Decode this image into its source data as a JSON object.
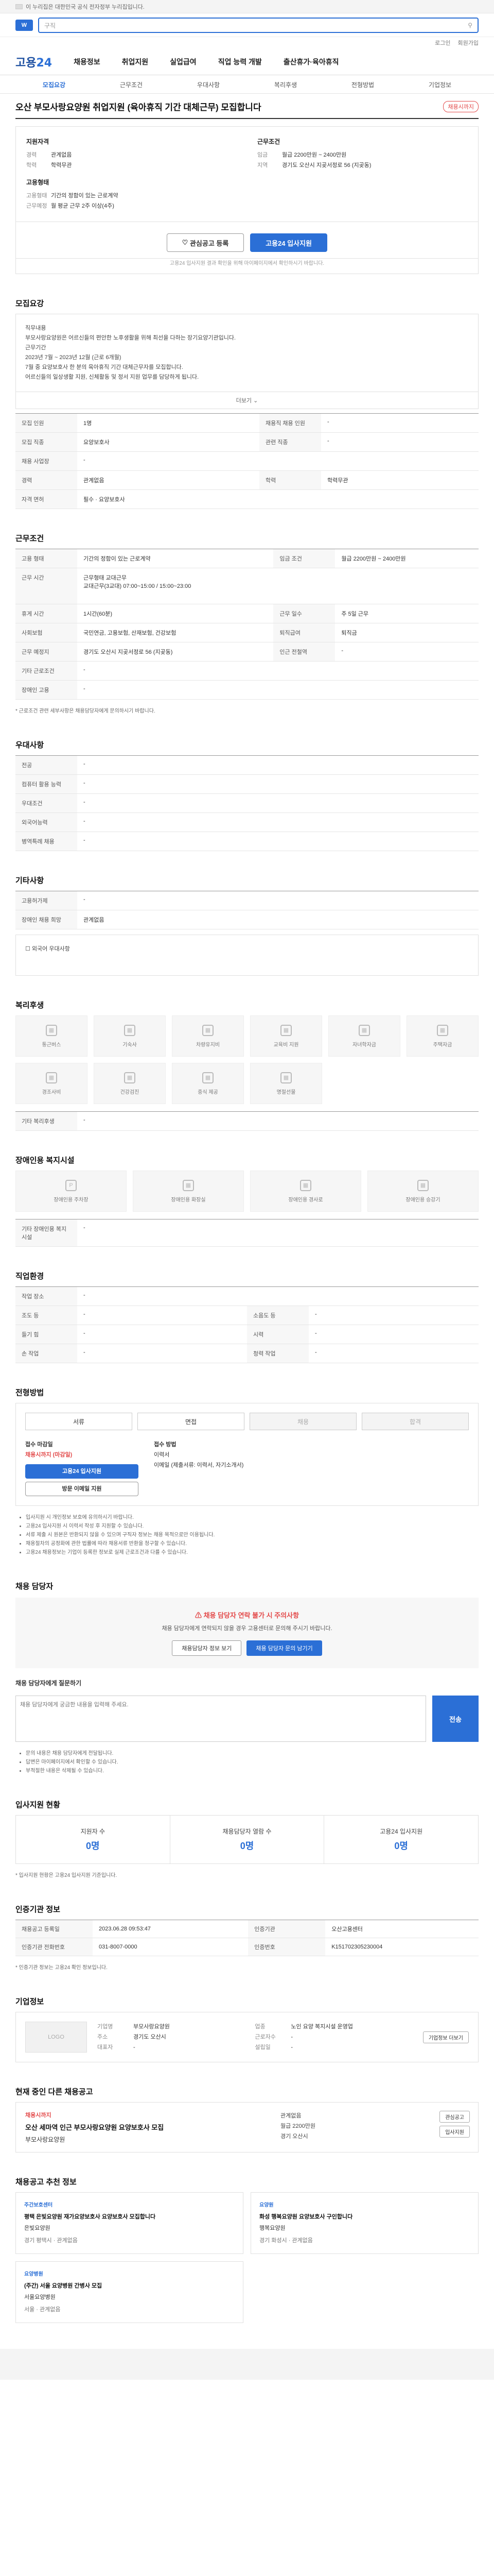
{
  "topbar": {
    "notice": "이 누리집은 대한민국 공식 전자정부 누리집입니다."
  },
  "search": {
    "placeholder": "구직"
  },
  "util": [
    "로그인",
    "회원가입"
  ],
  "gnb": {
    "brand_a": "고용",
    "brand_b": "24",
    "menu": [
      "채용정보",
      "취업지원",
      "실업급여",
      "직업 능력 개발",
      "출산휴가·육아휴직"
    ]
  },
  "lnb": [
    "모집요강",
    "근무조건",
    "우대사항",
    "복리후생",
    "전형방법",
    "기업정보"
  ],
  "title": {
    "text": "오산 부모사랑요양원 취업지원 (육아휴직 기간 대체근무) 모집합니다",
    "badge": "채용시까지"
  },
  "summary": {
    "left_h": "지원자격",
    "left": [
      [
        "경력",
        "관계없음"
      ],
      [
        "학력",
        "학력무관"
      ]
    ],
    "left2_h": "고용형태",
    "left2": [
      [
        "고용형태",
        "기간의 정함이 있는 근로계약"
      ],
      [
        "근무예정",
        "월 평균 근무 2주 이상(4주)"
      ]
    ],
    "right_h": "근무조건",
    "right": [
      [
        "임금",
        "월급 2200만원 ~ 2400만원"
      ],
      [
        "지역",
        "경기도 오산시 지곶서정로 56 (지곶동)"
      ]
    ]
  },
  "actions": {
    "save": "관심공고 등록",
    "apply": "고용24 입사지원"
  },
  "actions_note": "고용24 입사지원 결과 확인을 위해 마이페이지에서 확인하시기 바랍니다.",
  "s1": {
    "h": "모집요강",
    "text": [
      "직무내용",
      "부모사랑요양원은 어르신들의 편안한 노후생활을 위해 최선을 다하는 장기요양기관입니다.",
      "근무기간",
      "2023년 7월 ~ 2023년 12월 (근로 6개월)",
      "7월 중 요양보호사 한 분의 육아휴직 기간 대체근무자를 모집합니다.",
      "어르신들의 일상생활 지원, 신체활동 및 정서 지원 업무를 담당하게 됩니다."
    ],
    "more": "더보기"
  },
  "s1t": [
    [
      "모집 인원",
      "1명",
      "채용직 채용 인원",
      "-"
    ],
    [
      "모집 직종",
      "요양보호사",
      "관련 직종",
      "-"
    ],
    [
      "채용 사업장",
      "-",
      "",
      ""
    ],
    [
      "경력",
      "관계없음",
      "학력",
      "학력무관"
    ],
    [
      "자격 면허",
      "필수 · 요양보호사",
      "",
      ""
    ]
  ],
  "s2": {
    "h": "근무조건",
    "rows": [
      [
        "고용 형태",
        "기간의 정함이 있는 근로계약",
        "임금 조건",
        "월급 2200만원 ~ 2400만원"
      ],
      [
        "근무 시간",
        "근무형태 교대근무\n교대근무(3교대) 07:00~15:00 / 15:00~23:00",
        "",
        ""
      ],
      [
        "휴게 시간",
        "1시간(60분)",
        "근무 일수",
        "주 5일 근무"
      ],
      [
        "사회보험",
        "국민연금, 고용보험, 산재보험, 건강보험",
        "퇴직급여",
        "퇴직금"
      ],
      [
        "근무 예정지",
        "경기도 오산시 지곶서정로 56 (지곶동)",
        "인근 전철역",
        "-"
      ],
      [
        "기타 근로조건",
        "-",
        "",
        ""
      ],
      [
        "장애인 고용",
        "-",
        "",
        ""
      ]
    ],
    "note": "* 근로조건 관련 세부사항은 채용담당자에게 문의하시기 바랍니다."
  },
  "s3": {
    "h": "우대사항",
    "rows": [
      [
        "전공",
        "-"
      ],
      [
        "컴퓨터 활용 능력",
        "-"
      ],
      [
        "우대조건",
        "-"
      ],
      [
        "외국어능력",
        "-"
      ],
      [
        "병역특례 채용",
        "-"
      ]
    ]
  },
  "s4": {
    "h": "기타사항",
    "rows": [
      [
        "고용허가제",
        "-"
      ],
      [
        "장애인 채용 희망",
        "관계없음"
      ]
    ],
    "check": "외국어 우대사항"
  },
  "s5": {
    "h": "복리후생",
    "tiles": [
      "통근버스",
      "기숙사",
      "차량유지비",
      "교육비 지원",
      "자녀학자금",
      "주택자금",
      "경조사비",
      "건강검진",
      "중식 제공",
      "명절선물",
      "",
      ""
    ],
    "other_k": "기타 복리후생",
    "other_v": "-"
  },
  "s6": {
    "h": "장애인용 복지시설",
    "tiles": [
      "장애인용 주차장",
      "장애인용 화장실",
      "장애인용 경사로",
      "장애인용 승강기"
    ],
    "other_k": "기타 장애인용 복지시설",
    "other_v": "-"
  },
  "s7": {
    "h": "직업환경",
    "rows": [
      [
        "작업 장소",
        "-",
        "",
        ""
      ],
      [
        "조도 등",
        "-",
        "소음도 등",
        "-"
      ],
      [
        "들기 힘",
        "-",
        "시력",
        "-"
      ],
      [
        "손 작업",
        "-",
        "청력 작업",
        "-"
      ]
    ]
  },
  "s8": {
    "h": "전형방법",
    "tabs": [
      "서류",
      "면접",
      "채용",
      "합격"
    ],
    "l_h": "접수 마감일",
    "l_v": "채용시까지 (마감일)",
    "apply_btn": "고용24 입사지원",
    "visit_btn": "방문 이메일 지원",
    "r_h": "접수 방법",
    "r": [
      "이력서",
      "이메일 (제출서류: 이력서, 자기소개서)"
    ],
    "notes": [
      "입사지원 시 개인정보 보호에 유의하시기 바랍니다.",
      "고용24 입사지원 시 이력서 작성 후 지원할 수 있습니다.",
      "서류 제출 시 원본은 반환되지 않을 수 있으며 구직자 정보는 채용 목적으로만 이용됩니다.",
      "채용절차의 공정화에 관한 법률에 따라 채용서류 반환을 청구할 수 있습니다.",
      "고용24 채용정보는 기업이 등록한 정보로 실제 근로조건과 다를 수 있습니다."
    ]
  },
  "s9": {
    "h": "채용 담당자",
    "warn_t": "채용 담당자 연락 불가 시 주의사항",
    "warn_s": "채용 담당자에게 연락되지 않을 경우 고용센터로 문의해 주시기 바랍니다.",
    "btn1": "채용담당자 정보 보기",
    "btn2": "채용 담당자 문의 남기기",
    "inq_h": "채용 담당자에게 질문하기",
    "inq_ph": "채용 담당자에게 궁금한 내용을 입력해 주세요.",
    "send": "전송",
    "notes": [
      "문의 내용은 채용 담당자에게 전달됩니다.",
      "답변은 마이페이지에서 확인할 수 있습니다.",
      "부적절한 내용은 삭제될 수 있습니다."
    ]
  },
  "s10": {
    "h": "입사지원 현황",
    "stats": [
      [
        "지원자 수",
        "0명"
      ],
      [
        "채용담당자 열람 수",
        "0명"
      ],
      [
        "고용24 입사지원",
        "0명"
      ]
    ],
    "note": "* 입사지원 현황은 고용24 입사지원 기준입니다."
  },
  "s11": {
    "h": "인증기관 정보",
    "rows": [
      [
        "채용공고 등록일",
        "2023.06.28 09:53:47",
        "인증기관",
        "오산고용센터"
      ],
      [
        "인증기관 전화번호",
        "031-8007-0000",
        "인증번호",
        "K151702305230004"
      ]
    ],
    "note": "* 인증기관 정보는 고용24 확인 정보입니다."
  },
  "s12": {
    "h": "기업정보",
    "logo": "LOGO",
    "btn": "기업정보 더보기",
    "grid": [
      [
        "기업명",
        "부모사랑요양원",
        "업종",
        "노인 요양 복지시설 운영업"
      ],
      [
        "주소",
        "경기도 오산시",
        "근로자수",
        "-"
      ],
      [
        "대표자",
        "-",
        "설립일",
        "-"
      ]
    ]
  },
  "s13": {
    "h": "현재 중인 다른 채용공고",
    "item": {
      "t": "채용시까지",
      "n": "오산 세마역 인근 부모사랑요양원 요양보호사 모집",
      "c": "부모사랑요양원",
      "m": [
        "관계없음",
        "월급 2200만원",
        "경기 오산시"
      ],
      "p": [
        "관심공고",
        "입사지원"
      ]
    }
  },
  "s14": {
    "h": "채용공고 추천 정보",
    "cards": [
      {
        "t": "주간보호센터",
        "n": "평택 은빛요양원 재가요양보호사 요양보호사 모집합니다",
        "c": "은빛요양원",
        "m": "경기 평택시 · 관계없음"
      },
      {
        "t": "요양원",
        "n": "화성 행복요양원 요양보호사 구인합니다",
        "c": "행복요양원",
        "m": "경기 화성시 · 관계없음"
      },
      {
        "t": "요양병원",
        "n": "(주간) 서울 요양병원 간병사 모집",
        "c": "서울요양병원",
        "m": "서울 · 관계없음"
      }
    ]
  }
}
